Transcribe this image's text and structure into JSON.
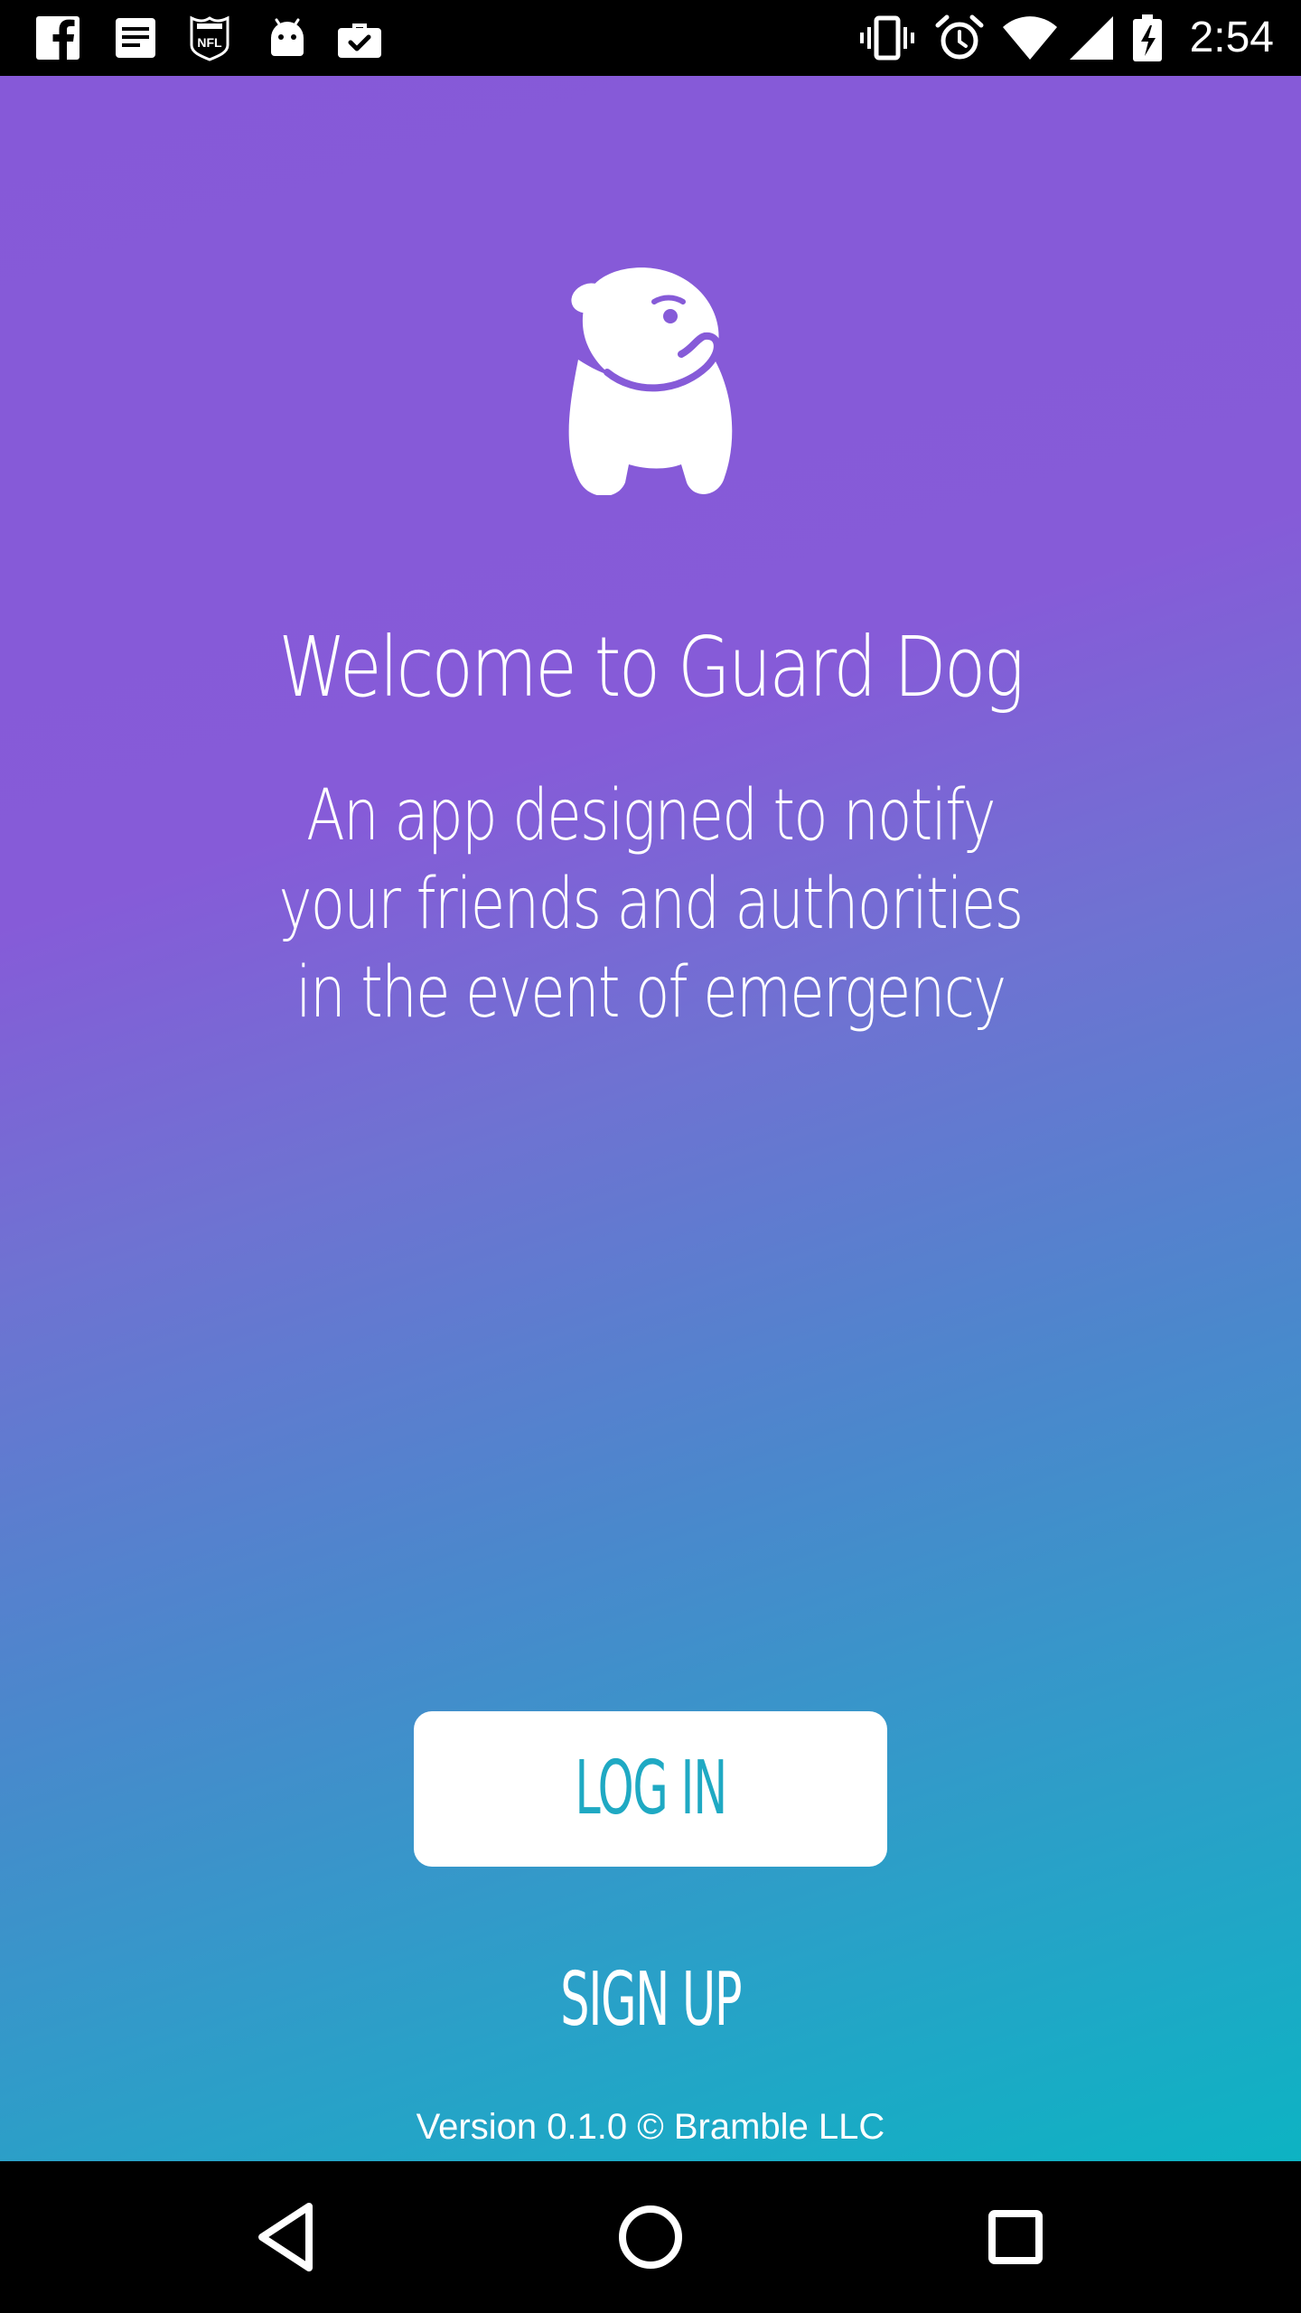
{
  "status_bar": {
    "time": "2:54",
    "notification_icons": [
      "facebook-icon",
      "news-icon",
      "nfl-icon",
      "android-icon",
      "work-briefcase-icon"
    ],
    "system_icons": [
      "vibrate-icon",
      "alarm-icon",
      "wifi-icon",
      "cell-signal-icon",
      "battery-charging-icon"
    ]
  },
  "welcome": {
    "logo_icon": "bulldog-icon",
    "title": "Welcome to Guard Dog",
    "subtitle": "An app designed to notify your friends and authorities in the event of emergency"
  },
  "actions": {
    "login_label": "LOG IN",
    "signup_label": "SIGN UP"
  },
  "footer": {
    "version": "Version 0.1.0 © Bramble LLC"
  },
  "nav_bar": {
    "buttons": [
      "back-icon",
      "home-icon",
      "recents-icon"
    ]
  },
  "colors": {
    "gradient_top": "#8659d8",
    "gradient_bottom": "#0db3c3",
    "login_text": "#1fa9c3"
  }
}
